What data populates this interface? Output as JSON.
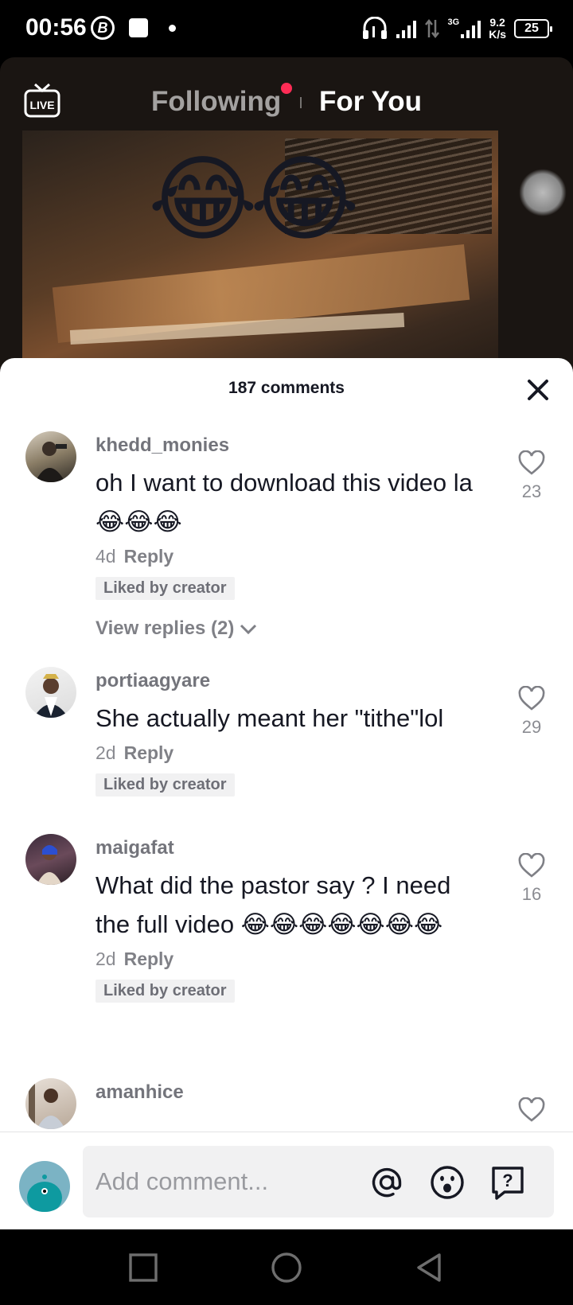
{
  "status_bar": {
    "time": "00:56",
    "b_icon_label": "B",
    "net_type": "3G",
    "net_speed_value": "9.2",
    "net_speed_unit": "K/s",
    "battery": "25",
    "icons": [
      "b-circle-icon",
      "app-square-icon",
      "dot-icon",
      "headset-icon",
      "signal-icon",
      "data-arrows-icon",
      "signal-3g-icon",
      "battery-icon"
    ]
  },
  "video": {
    "tabs": {
      "following": "Following",
      "for_you": "For You"
    },
    "live_label": "LIVE",
    "overlay_emojis": [
      "😂",
      "😂"
    ]
  },
  "comments_header": {
    "count_label": "187 comments"
  },
  "comments": [
    {
      "username": "khedd_monies",
      "text": "oh I want to download this video la 😂😂😂",
      "age": "4d",
      "reply": "Reply",
      "badge": "Liked by creator",
      "likes": "23",
      "view_replies": "View replies (2)"
    },
    {
      "username": "portiaagyare",
      "text": "She actually meant her \"tithe\"lol",
      "age": "2d",
      "reply": "Reply",
      "badge": "Liked by creator",
      "likes": "29"
    },
    {
      "username": "maigafat",
      "text": "What did the pastor say ? I need the full video 😂😂😂😂😂😂😂",
      "age": "2d",
      "reply": "Reply",
      "badge": "Liked by creator",
      "likes": "16"
    },
    {
      "username": "amanhice",
      "text": "",
      "age": "",
      "reply": "",
      "likes": ""
    }
  ],
  "composer": {
    "placeholder": "Add comment...",
    "icons": [
      "mention-icon",
      "emoji-icon",
      "question-icon"
    ]
  },
  "colors": {
    "accent": "#fe2c55",
    "text": "#161823",
    "muted": "#8a8b91",
    "badge_bg": "#f1f1f2"
  }
}
